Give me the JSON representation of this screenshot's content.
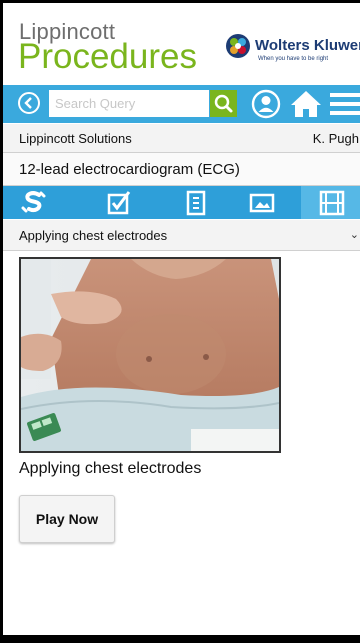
{
  "header": {
    "brand_small": "Lippincott",
    "brand_big": "Procedures",
    "publisher": "Wolters Kluwer",
    "publisher_tagline": "When you have to be right"
  },
  "search": {
    "placeholder": "Search Query"
  },
  "icons": {
    "back": "back-circle-icon",
    "search": "search-icon",
    "user": "user-icon",
    "home": "home-icon",
    "menu": "menu-icon"
  },
  "info": {
    "solutions": "Lippincott Solutions",
    "user_name": "K. Pugh"
  },
  "procedure": {
    "title": "12-lead electrocardiogram (ECG)"
  },
  "tabs": [
    {
      "icon": "skills-icon"
    },
    {
      "icon": "checklist-icon"
    },
    {
      "icon": "document-icon"
    },
    {
      "icon": "image-icon"
    },
    {
      "icon": "video-icon",
      "active": true
    }
  ],
  "section": {
    "selected": "Applying chest electrodes"
  },
  "video": {
    "caption": "Applying chest electrodes",
    "play_label": "Play Now"
  },
  "colors": {
    "brand_green": "#7ab51d",
    "bar_blue": "#3aa9dd",
    "tab_blue": "#2e9fd9",
    "tab_active": "#56b8e6",
    "publisher_navy": "#1d3c74"
  }
}
